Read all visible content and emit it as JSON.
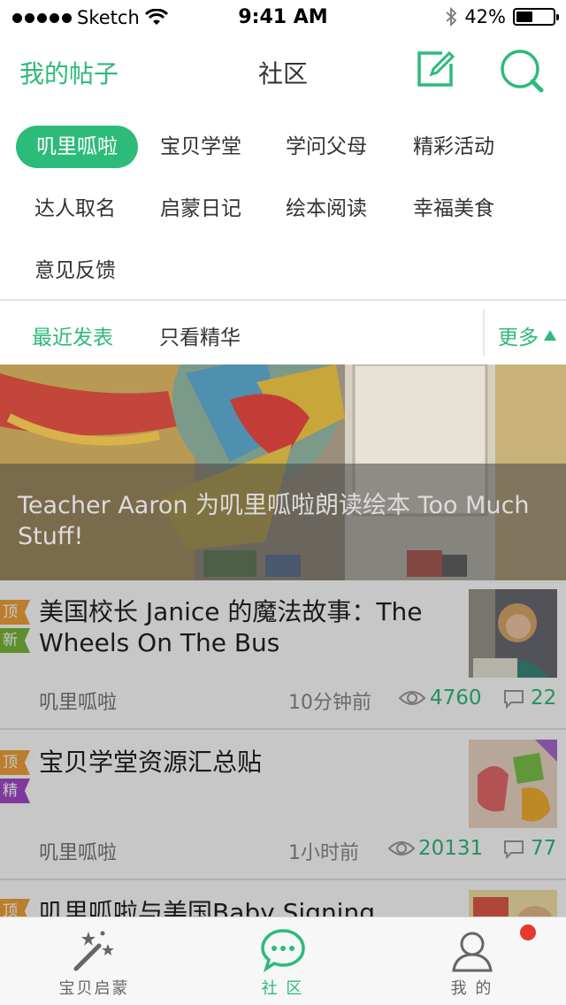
{
  "status_bar": {
    "carrier": "Sketch",
    "time": "9:41 AM",
    "battery": "42%",
    "icons": [
      "signal-dots",
      "wifi-icon",
      "bluetooth-icon",
      "battery-icon"
    ]
  },
  "nav": {
    "left_label": "我的帖子",
    "title": "社区",
    "icons": [
      "compose-icon",
      "search-icon"
    ],
    "accent": "#2dbb7a"
  },
  "tags": {
    "items": [
      {
        "label": "叽里呱啦",
        "active": true
      },
      {
        "label": "宝贝学堂",
        "active": false
      },
      {
        "label": "学问父母",
        "active": false
      },
      {
        "label": "精彩活动",
        "active": false
      },
      {
        "label": "达人取名",
        "active": false
      },
      {
        "label": "启蒙日记",
        "active": false
      },
      {
        "label": "绘本阅读",
        "active": false
      },
      {
        "label": "幸福美食",
        "active": false
      },
      {
        "label": "意见反馈",
        "active": false
      }
    ]
  },
  "filter": {
    "recent": "最近发表",
    "featured": "只看精华",
    "more": "更多"
  },
  "banner": {
    "caption": "Teacher Aaron 为叽里呱啦朗读绘本 Too Much Stuff!"
  },
  "feed": {
    "items": [
      {
        "badges": [
          {
            "text": "顶",
            "type": "top"
          },
          {
            "text": "新",
            "type": "new"
          }
        ],
        "title": "美国校长 Janice 的魔法故事：The Wheels On The Bus",
        "author": "叽里呱啦",
        "time": "10分钟前",
        "views": "4760",
        "comments": "22"
      },
      {
        "badges": [
          {
            "text": "顶",
            "type": "top"
          },
          {
            "text": "精",
            "type": "jing"
          }
        ],
        "title": "宝贝学堂资源汇总贴",
        "author": "叽里呱啦",
        "time": "1小时前",
        "views": "20131",
        "comments": "77"
      },
      {
        "badges": [
          {
            "text": "顶",
            "type": "top"
          }
        ],
        "title": "叽里呱啦与美国Baby Signing",
        "author": "",
        "time": "",
        "views": "",
        "comments": ""
      }
    ]
  },
  "tabbar": {
    "tabs": [
      {
        "label": "宝贝启蒙",
        "icon": "magic-wand-icon",
        "active": false
      },
      {
        "label": "社 区",
        "icon": "chat-bubble-icon",
        "active": true
      },
      {
        "label": "我 的",
        "icon": "user-icon",
        "active": false,
        "notification_dot": true
      }
    ]
  }
}
